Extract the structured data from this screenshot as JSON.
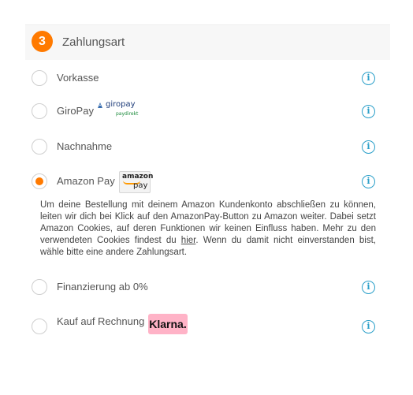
{
  "section": {
    "step_number": "3",
    "title": "Zahlungsart"
  },
  "options": [
    {
      "label": "Vorkasse",
      "checked": false
    },
    {
      "label": "GiroPay",
      "checked": false,
      "logo_text": "giropay",
      "logo_subtext": "paydirekt"
    },
    {
      "label": "Nachnahme",
      "checked": false
    },
    {
      "label": "Amazon Pay",
      "checked": true,
      "logo_text": "amazon",
      "logo_subtext": "pay"
    },
    {
      "label": "Finanzierung ab 0%",
      "checked": false
    },
    {
      "label": "Kauf auf Rechnung",
      "checked": false,
      "logo_text": "Klarna."
    }
  ],
  "info_icon_glyph": "i",
  "amazon_info": {
    "text_before_link": "Um deine Bestellung mit deinem Amazon Kundenkonto abschließen zu können, leiten wir dich bei Klick auf den AmazonPay-Button zu Amazon weiter. Dabei setzt Amazon Cookies, auf deren Funktionen wir keinen Einfluss haben. Mehr zu den verwendeten Cookies findest du ",
    "link_text": "hier",
    "text_after_link": ". Wenn du damit nicht einverstanden bist, wähle bitte eine andere Zahlungsart."
  },
  "colors": {
    "accent": "#ff7a00",
    "info": "#2a9fc9",
    "klarna": "#ffb3c7"
  }
}
